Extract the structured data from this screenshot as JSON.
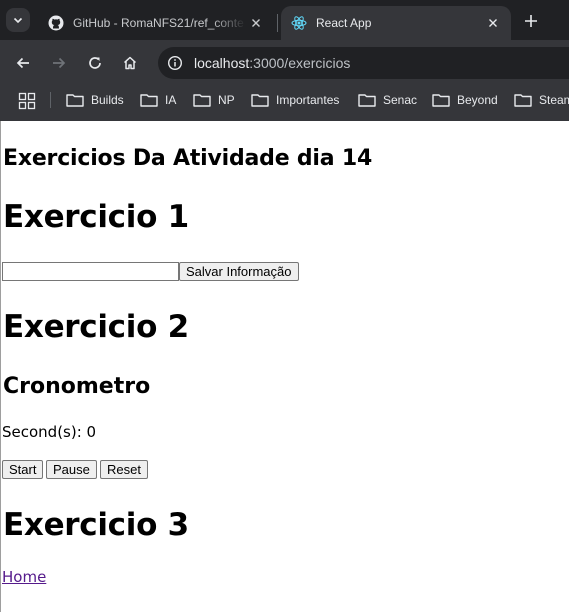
{
  "browser": {
    "tabs": [
      {
        "title": "GitHub - RomaNFS21/ref_conte",
        "active": false,
        "favicon": "github-icon"
      },
      {
        "title": "React App",
        "active": true,
        "favicon": "react-icon"
      }
    ],
    "url_host": "localhost",
    "url_path": ":3000/exercicios",
    "bookmarks": [
      "Builds",
      "IA",
      "NP",
      "Importantes",
      "Senac",
      "Beyond",
      "Steam"
    ]
  },
  "page": {
    "heading": "Exercicios Da Atividade dia 14",
    "exercise1": {
      "title": "Exercicio 1",
      "input_value": "",
      "save_button": "Salvar Informação"
    },
    "exercise2": {
      "title": "Exercicio 2",
      "subtitle": "Cronometro",
      "seconds_label": "Second(s): 0",
      "start_button": "Start",
      "pause_button": "Pause",
      "reset_button": "Reset"
    },
    "exercise3": {
      "title": "Exercicio 3",
      "home_link": "Home"
    }
  },
  "colors": {
    "chrome_dark": "#202124",
    "chrome_toolbar": "#35363a",
    "link_visited": "#551a8b"
  }
}
